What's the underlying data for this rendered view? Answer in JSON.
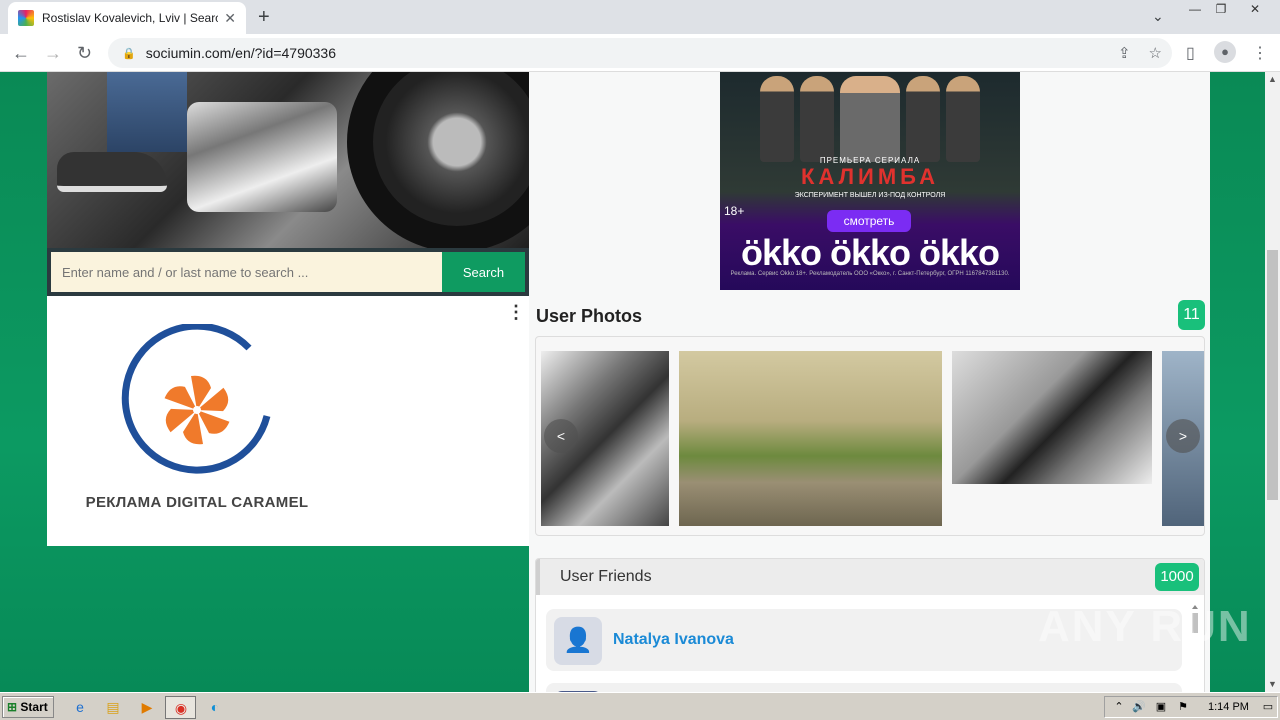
{
  "browser": {
    "tab_title": "Rostislav Kovalevich, Lviv | Search I...",
    "tab_close": "✕",
    "new_tab": "+",
    "url": "sociumin.com/en/?id=4790336",
    "window_controls": [
      "—",
      "❐",
      "✕"
    ]
  },
  "page": {
    "search": {
      "placeholder": "Enter name and / or last name to search ...",
      "button": "Search"
    },
    "ad_left": {
      "brand": "РЕКЛАМА DIGITAL CARAMEL",
      "menu": "⋮"
    },
    "ad_right": {
      "premiere": "ПРЕМЬЕРА СЕРИАЛА",
      "title": "КАЛИМБА",
      "subtitle": "ЭКСПЕРИМЕНТ ВЫШЕЛ ИЗ-ПОД КОНТРОЛЯ",
      "age": "18+",
      "watch": "смотреть",
      "logos": "ökko ökko ökko",
      "legal": "Реклама. Сервис Okko 18+. Рекламодатель ООО «Окко», г. Санкт-Петербург, ОГРН 1167847381130."
    },
    "photos": {
      "title": "User Photos",
      "count": "11",
      "prev": "<",
      "next": ">"
    },
    "friends": {
      "title": "User Friends",
      "count": "1000",
      "items": [
        {
          "name": "Natalya Ivanova"
        }
      ]
    },
    "watermark": "ANY RUN"
  },
  "taskbar": {
    "start": "Start",
    "time": "1:14 PM"
  },
  "colors": {
    "page_green": "#0a8a55",
    "accent_green": "#19c07b",
    "link_blue": "#1b8ad6",
    "logo_blue": "#1f4f9a",
    "logo_orange": "#f07a2b"
  }
}
